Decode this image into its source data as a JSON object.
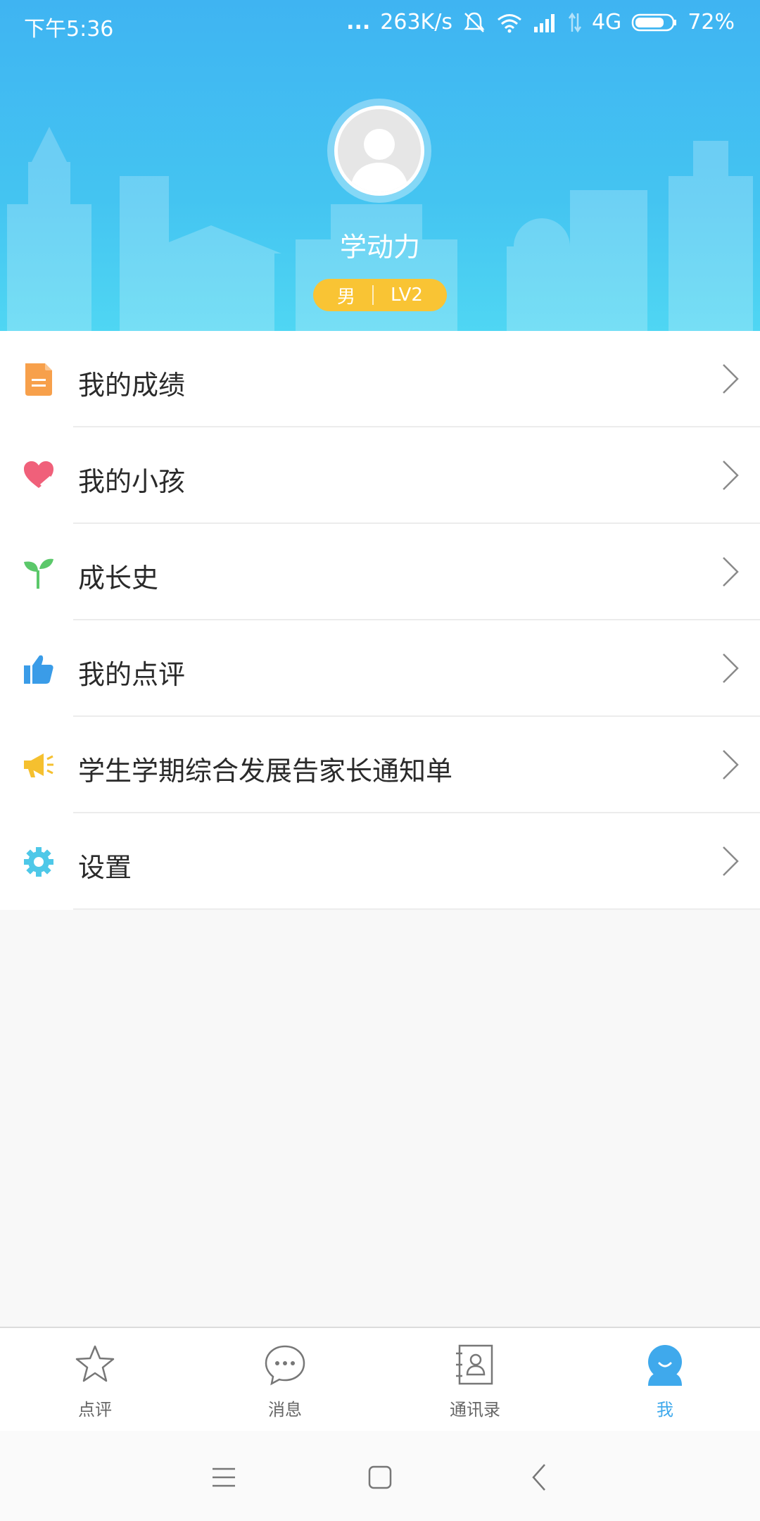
{
  "status_bar": {
    "time": "下午5:36",
    "more": "...",
    "speed": "263K/s",
    "network": "4G",
    "battery": "72%",
    "battery_level": 0.72
  },
  "profile": {
    "name": "学动力",
    "gender": "男",
    "level": "LV2"
  },
  "menu": [
    {
      "label": "我的成绩",
      "icon": "document-icon",
      "color": "#f7a04b"
    },
    {
      "label": "我的小孩",
      "icon": "heart-icon",
      "color": "#f0607a"
    },
    {
      "label": "成长史",
      "icon": "sprout-icon",
      "color": "#5bc86a"
    },
    {
      "label": "我的点评",
      "icon": "thumbs-up-icon",
      "color": "#3a9ce8"
    },
    {
      "label": "学生学期综合发展告家长通知单",
      "icon": "megaphone-icon",
      "color": "#f5c02f"
    },
    {
      "label": "设置",
      "icon": "gear-icon",
      "color": "#4ec8e8"
    }
  ],
  "tabs": [
    {
      "label": "点评",
      "icon": "star-icon",
      "active": false
    },
    {
      "label": "消息",
      "icon": "chat-bubble-icon",
      "active": false
    },
    {
      "label": "通讯录",
      "icon": "contacts-book-icon",
      "active": false
    },
    {
      "label": "我",
      "icon": "profile-face-icon",
      "active": true
    }
  ],
  "colors": {
    "header_top": "#3fb4f2",
    "header_bottom": "#4fd6f3",
    "badge": "#f9c434",
    "accent": "#3fa9ec"
  }
}
